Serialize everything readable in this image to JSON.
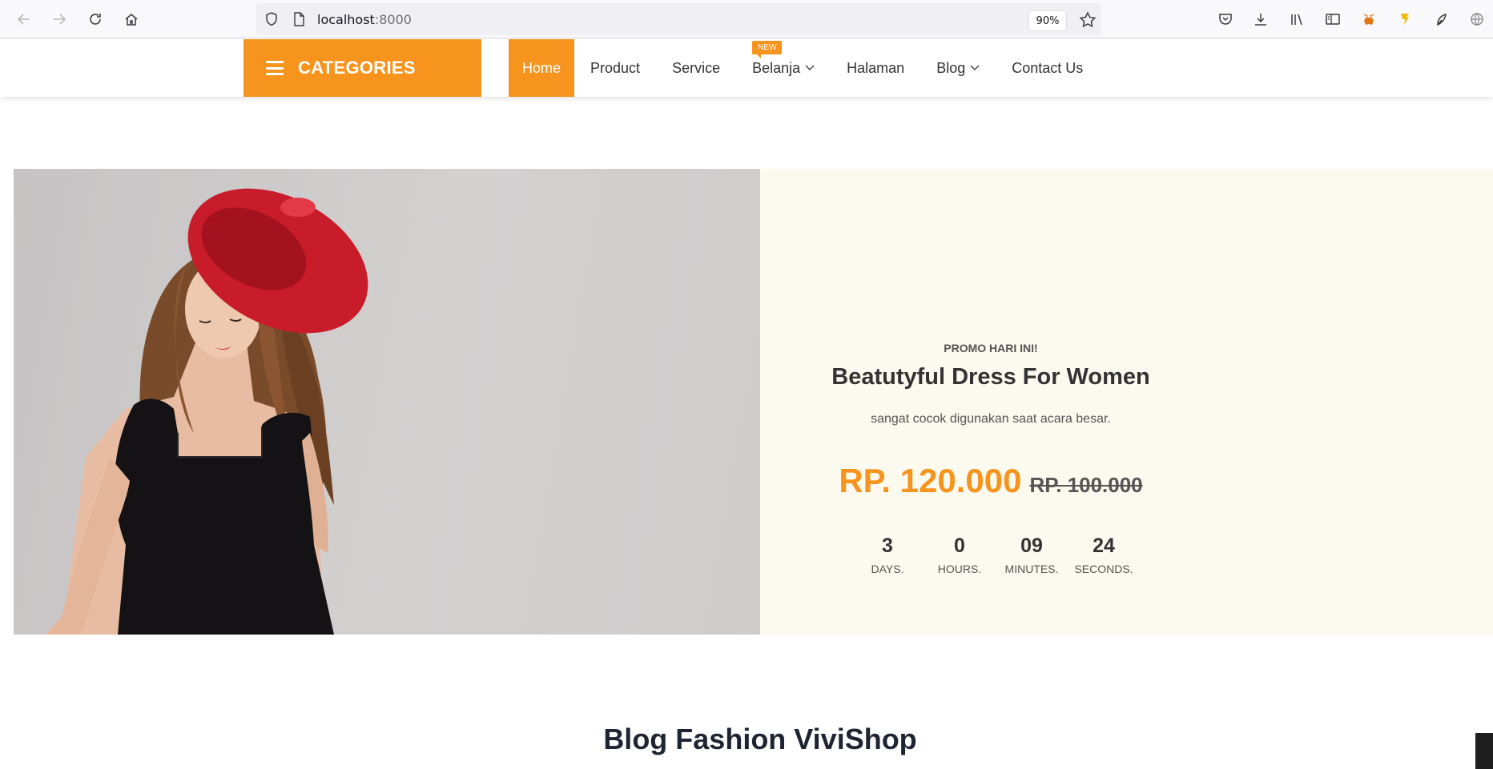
{
  "browser": {
    "url_host": "localhost",
    "url_port": ":8000",
    "zoom": "90%",
    "icons": [
      "back-icon",
      "forward-icon",
      "reload-icon",
      "home-icon",
      "shield-icon",
      "page-icon",
      "star-icon",
      "pocket-icon",
      "download-icon",
      "library-icon",
      "sidebar-icon",
      "metamask-icon",
      "extension-icon",
      "extension-icon",
      "globe-icon"
    ]
  },
  "navbar": {
    "categories_label": "CATEGORIES",
    "menu": [
      {
        "label": "Home",
        "active": true
      },
      {
        "label": "Product"
      },
      {
        "label": "Service"
      },
      {
        "label": "Belanja",
        "badge": "NEW",
        "dropdown": true
      },
      {
        "label": "Halaman"
      },
      {
        "label": "Blog",
        "dropdown": true
      },
      {
        "label": "Contact Us"
      }
    ]
  },
  "promo": {
    "subtitle": "PROMO HARI INI!",
    "title": "Beatutyful Dress For Women",
    "description": "sangat cocok digunakan saat acara besar.",
    "price_new": "RP. 120.000",
    "price_old": "RP. 100.000",
    "countdown": [
      {
        "value": "3",
        "label": "DAYS."
      },
      {
        "value": "0",
        "label": "HOURS."
      },
      {
        "value": "09",
        "label": "MINUTES."
      },
      {
        "value": "24",
        "label": "SECONDS."
      }
    ]
  },
  "blog": {
    "section_title": "Blog Fashion ViviShop"
  },
  "colors": {
    "accent": "#f7941d",
    "panel": "#fcf9ee",
    "text_dark": "#333333"
  }
}
